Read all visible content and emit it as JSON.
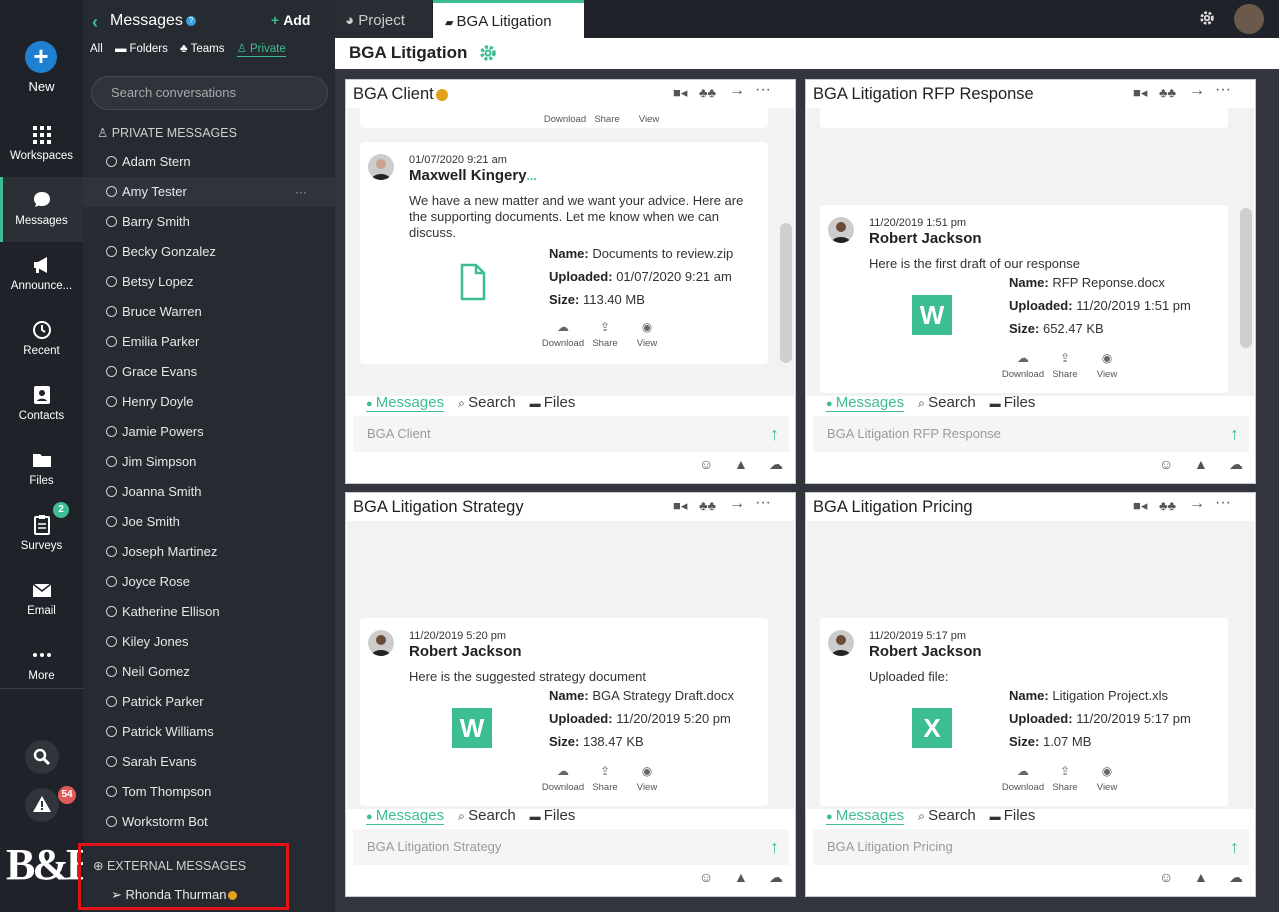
{
  "rail": {
    "new_label": "New",
    "items": [
      {
        "label": "Workspaces",
        "icon": "grid-icon"
      },
      {
        "label": "Messages",
        "icon": "chat-icon"
      },
      {
        "label": "Announce...",
        "icon": "megaphone-icon"
      },
      {
        "label": "Recent",
        "icon": "history-icon"
      },
      {
        "label": "Contacts",
        "icon": "contacts-icon"
      },
      {
        "label": "Files",
        "icon": "folder-icon"
      },
      {
        "label": "Surveys",
        "icon": "clipboard-icon",
        "badge": "2"
      },
      {
        "label": "Email",
        "icon": "envelope-icon"
      },
      {
        "label": "More",
        "icon": "more-icon"
      }
    ],
    "alert_badge": "54",
    "logo": "B&B"
  },
  "conversations": {
    "title": "Messages",
    "add_label": "Add",
    "filters": [
      "All",
      "Folders",
      "Teams",
      "Private"
    ],
    "search_placeholder": "Search conversations",
    "private_header": "PRIVATE MESSAGES",
    "contacts": [
      "Adam Stern",
      "Amy Tester",
      "Barry Smith",
      "Becky Gonzalez",
      "Betsy Lopez",
      "Bruce Warren",
      "Emilia Parker",
      "Grace Evans",
      "Henry Doyle",
      "Jamie Powers",
      "Jim Simpson",
      "Joanna Smith",
      "Joe Smith",
      "Joseph Martinez",
      "Joyce Rose",
      "Katherine Ellison",
      "Kiley Jones",
      "Neil Gomez",
      "Patrick Parker",
      "Patrick Williams",
      "Sarah Evans",
      "Tom Thompson",
      "Workstorm Bot"
    ],
    "more_glyph": "···",
    "external_header": "EXTERNAL MESSAGES",
    "external_contact": "Rhonda Thurman"
  },
  "tabs": {
    "project": "Project",
    "bga": "BGA Litigation"
  },
  "page": {
    "title": "BGA Litigation"
  },
  "labels": {
    "name": "Name:",
    "uploaded": "Uploaded:",
    "size": "Size:",
    "download": "Download",
    "share": "Share",
    "view": "View",
    "messages": "Messages",
    "search": "Search",
    "files": "Files"
  },
  "cards": [
    {
      "title": "BGA Client",
      "composer_placeholder": "BGA Client",
      "message": {
        "time": "01/07/2020 9:21 am",
        "author": "Maxwell Kingery",
        "author_suffix": "...",
        "text": "We have a new matter and we want your advice. Here are the supporting documents. Let me know when we can discuss.",
        "file_type": "generic-file-icon",
        "file_name": "Documents to review.zip",
        "file_uploaded": "01/07/2020 9:21 am",
        "file_size": "113.40 MB"
      }
    },
    {
      "title": "BGA Litigation RFP Response",
      "composer_placeholder": "BGA Litigation RFP Response",
      "message": {
        "time": "11/20/2019 1:51 pm",
        "author": "Robert Jackson",
        "text": "Here is the first draft of our response",
        "file_type": "word-icon",
        "file_letter": "W",
        "file_name": "RFP Reponse.docx",
        "file_uploaded": "11/20/2019 1:51 pm",
        "file_size": "652.47 KB"
      }
    },
    {
      "title": "BGA Litigation Strategy",
      "composer_placeholder": "BGA Litigation Strategy",
      "message": {
        "time": "11/20/2019 5:20 pm",
        "author": "Robert Jackson",
        "text": "Here is the suggested strategy document",
        "file_type": "word-icon",
        "file_letter": "W",
        "file_name": "BGA Strategy Draft.docx",
        "file_uploaded": "11/20/2019 5:20 pm",
        "file_size": "138.47 KB"
      }
    },
    {
      "title": "BGA Litigation Pricing",
      "composer_placeholder": "BGA Litigation Pricing",
      "message": {
        "time": "11/20/2019 5:17 pm",
        "author": "Robert Jackson",
        "text": "Uploaded file:",
        "file_type": "excel-icon",
        "file_letter": "X",
        "file_name": "Litigation Project.xls",
        "file_uploaded": "11/20/2019 5:17 pm",
        "file_size": "1.07 MB"
      }
    }
  ],
  "colors": {
    "accent": "#3dbd93",
    "rail_bg": "#1f2228",
    "panel_bg": "#262a31",
    "highlight_box": "#e3131a",
    "new_button": "#1f7fd1"
  }
}
